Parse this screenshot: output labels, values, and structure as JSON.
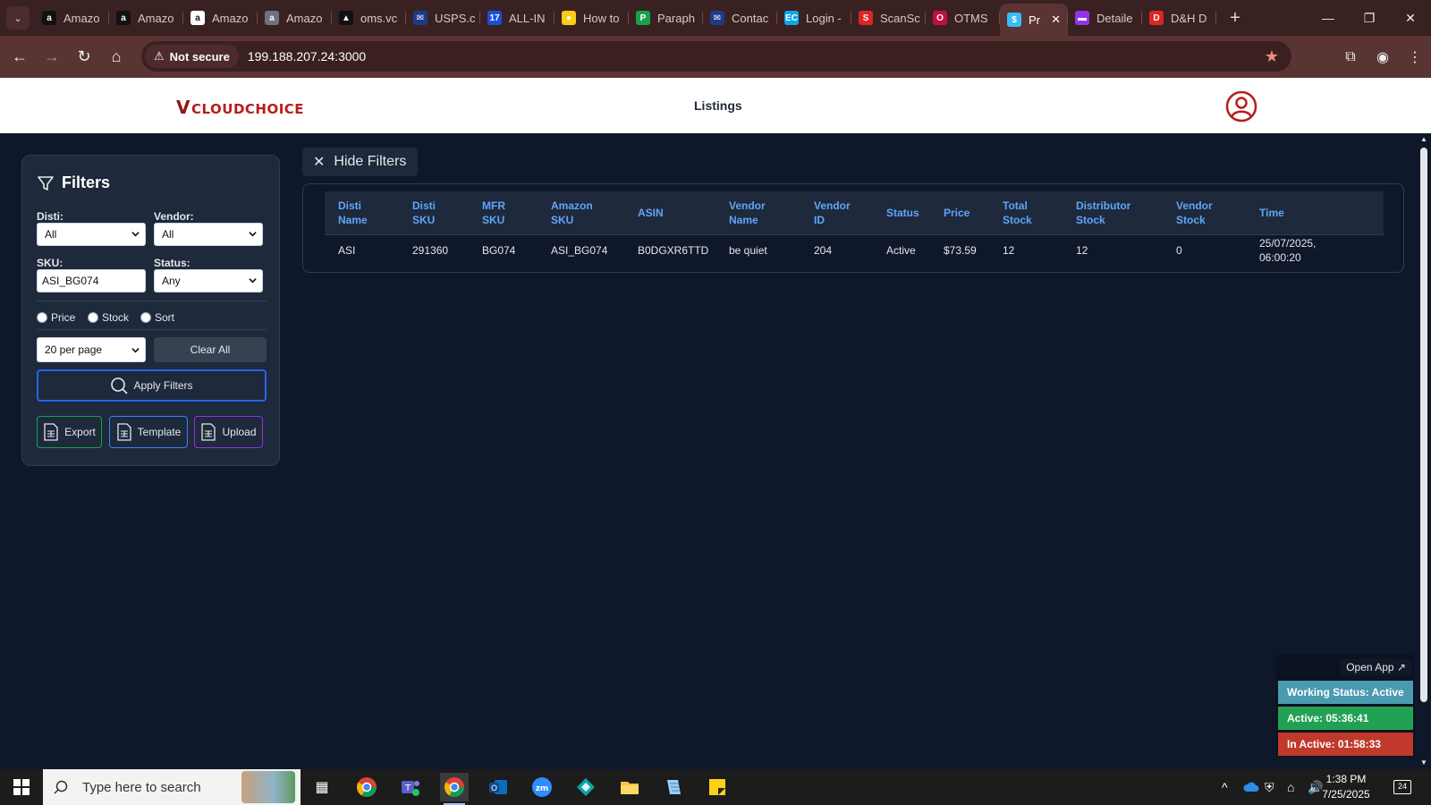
{
  "browser": {
    "tabs": [
      {
        "label": "Amazo",
        "fav": "a",
        "color": "#111111"
      },
      {
        "label": "Amazo",
        "fav": "a",
        "color": "#111111"
      },
      {
        "label": "Amazo",
        "fav": "a",
        "color": "#ffffff"
      },
      {
        "label": "Amazo",
        "fav": "a",
        "color": "#6b7280"
      },
      {
        "label": "oms.vc",
        "fav": "▲",
        "color": "#111111"
      },
      {
        "label": "USPS.c",
        "fav": "✉",
        "color": "#1e3a8a"
      },
      {
        "label": "ALL-IN",
        "fav": "17",
        "color": "#1d4ed8"
      },
      {
        "label": "How to",
        "fav": "●",
        "color": "#facc15"
      },
      {
        "label": "Paraph",
        "fav": "P",
        "color": "#16a34a"
      },
      {
        "label": "Contac",
        "fav": "✉",
        "color": "#1e3a8a"
      },
      {
        "label": "Login -",
        "fav": "EC",
        "color": "#0ea5e9"
      },
      {
        "label": "ScanSc",
        "fav": "S",
        "color": "#dc2626"
      },
      {
        "label": "OTMS",
        "fav": "O",
        "color": "#be123c"
      },
      {
        "label": "Pr",
        "fav": "$",
        "color": "#38bdf8",
        "active": true
      },
      {
        "label": "Detaile",
        "fav": "▬",
        "color": "#9333ea"
      },
      {
        "label": "D&H D",
        "fav": "D",
        "color": "#dc2626"
      }
    ],
    "security_label": "Not secure",
    "url": "199.188.207.24:3000"
  },
  "app": {
    "logo_text": "CLOUDCHOICE",
    "logo_v": "V",
    "nav_title": "Listings"
  },
  "filters": {
    "title": "Filters",
    "disti_label": "Disti:",
    "disti_value": "All",
    "vendor_label": "Vendor:",
    "vendor_value": "All",
    "sku_label": "SKU:",
    "sku_value": "ASI_BG074",
    "status_label": "Status:",
    "status_value": "Any",
    "radios": [
      "Price",
      "Stock",
      "Sort"
    ],
    "per_page": "20 per page",
    "clear_all": "Clear All",
    "apply": "Apply Filters",
    "export": "Export",
    "template": "Template",
    "upload": "Upload",
    "hide_filters": "Hide Filters"
  },
  "table": {
    "headers": [
      [
        "Disti",
        "Name"
      ],
      [
        "Disti",
        "SKU"
      ],
      [
        "MFR",
        "SKU"
      ],
      [
        "Amazon",
        "SKU"
      ],
      [
        "ASIN"
      ],
      [
        "Vendor",
        "Name"
      ],
      [
        "Vendor",
        "ID"
      ],
      [
        "Status"
      ],
      [
        "Price"
      ],
      [
        "Total",
        "Stock"
      ],
      [
        "Distributor",
        "Stock"
      ],
      [
        "Vendor",
        "Stock"
      ],
      [
        "Time"
      ]
    ],
    "rows": [
      [
        "ASI",
        "291360",
        "BG074",
        "ASI_BG074",
        "B0DGXR6TTD",
        "be quiet",
        "204",
        "Active",
        "$73.59",
        "12",
        "12",
        "0",
        "25/07/2025,|06:00:20"
      ]
    ]
  },
  "widget": {
    "open_app": "Open App ↗",
    "working_status": "Working Status: Active",
    "active_time": "Active: 05:36:41",
    "inactive_time": "In Active: 01:58:33"
  },
  "taskbar": {
    "search_placeholder": "Type here to search",
    "time": "1:38 PM",
    "date": "7/25/2025",
    "notif_count": "24"
  }
}
